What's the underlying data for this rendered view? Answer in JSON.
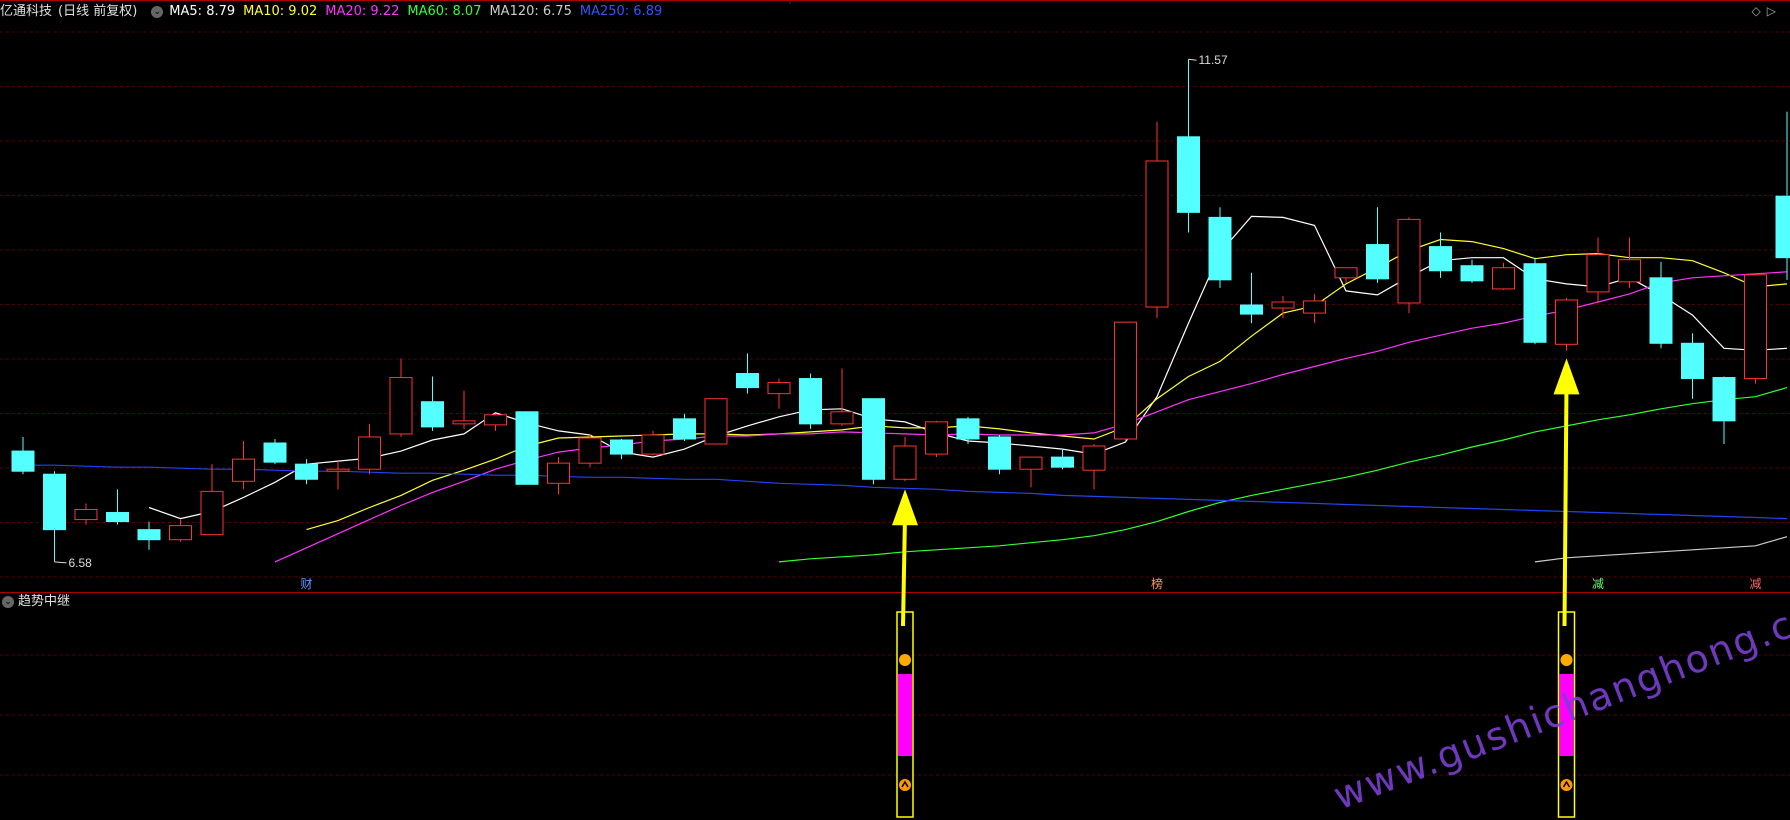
{
  "header": {
    "stock_name": "亿通科技",
    "period_label": "(日线 前复权)",
    "ma_labels": [
      {
        "label": "MA5: 8.79",
        "color": "#ffffff"
      },
      {
        "label": "MA10: 9.02",
        "color": "#ffff33"
      },
      {
        "label": "MA20: 9.22",
        "color": "#ff33ff"
      },
      {
        "label": "MA60: 8.07",
        "color": "#33ff33"
      },
      {
        "label": "MA120: 6.75",
        "color": "#cccccc"
      },
      {
        "label": "MA250: 6.89",
        "color": "#3355ff"
      }
    ]
  },
  "indicator": {
    "name": "趋势中继"
  },
  "chart_data": {
    "type": "candlestick",
    "price_high_label": "11.57",
    "price_low_label": "6.58",
    "y_range": [
      6.4,
      11.9
    ],
    "candles": [
      {
        "o": 7.68,
        "h": 7.82,
        "c": 7.48,
        "l": 7.45,
        "up": false
      },
      {
        "o": 7.45,
        "h": 7.48,
        "c": 6.9,
        "l": 6.58,
        "up": false
      },
      {
        "o": 7.0,
        "h": 7.16,
        "c": 7.1,
        "l": 6.95,
        "up": true
      },
      {
        "o": 7.07,
        "h": 7.3,
        "c": 6.98,
        "l": 6.95,
        "up": false
      },
      {
        "o": 6.9,
        "h": 6.98,
        "c": 6.8,
        "l": 6.7,
        "up": false
      },
      {
        "o": 6.8,
        "h": 7.0,
        "c": 6.94,
        "l": 6.78,
        "up": true
      },
      {
        "o": 6.85,
        "h": 7.55,
        "c": 7.28,
        "l": 6.85,
        "up": true
      },
      {
        "o": 7.38,
        "h": 7.78,
        "c": 7.6,
        "l": 7.3,
        "up": true
      },
      {
        "o": 7.76,
        "h": 7.8,
        "c": 7.57,
        "l": 7.55,
        "up": false
      },
      {
        "o": 7.55,
        "h": 7.6,
        "c": 7.4,
        "l": 7.35,
        "up": false
      },
      {
        "o": 7.5,
        "h": 7.58,
        "c": 7.48,
        "l": 7.3,
        "up": true
      },
      {
        "o": 7.5,
        "h": 7.95,
        "c": 7.82,
        "l": 7.45,
        "up": true
      },
      {
        "o": 7.85,
        "h": 8.6,
        "c": 8.41,
        "l": 7.82,
        "up": true
      },
      {
        "o": 8.17,
        "h": 8.42,
        "c": 7.92,
        "l": 7.88,
        "up": false
      },
      {
        "o": 7.98,
        "h": 8.28,
        "c": 7.95,
        "l": 7.9,
        "up": true
      },
      {
        "o": 7.94,
        "h": 8.05,
        "c": 8.04,
        "l": 7.88,
        "up": true
      },
      {
        "o": 8.07,
        "h": 8.07,
        "c": 7.35,
        "l": 7.35,
        "up": false
      },
      {
        "o": 7.36,
        "h": 7.62,
        "c": 7.56,
        "l": 7.25,
        "up": true
      },
      {
        "o": 7.56,
        "h": 7.85,
        "c": 7.81,
        "l": 7.52,
        "up": true
      },
      {
        "o": 7.79,
        "h": 7.8,
        "c": 7.65,
        "l": 7.6,
        "up": false
      },
      {
        "o": 7.65,
        "h": 7.88,
        "c": 7.84,
        "l": 7.64,
        "up": true
      },
      {
        "o": 8.0,
        "h": 8.05,
        "c": 7.8,
        "l": 7.78,
        "up": false
      },
      {
        "o": 7.75,
        "h": 8.15,
        "c": 8.2,
        "l": 7.75,
        "up": true
      },
      {
        "o": 8.45,
        "h": 8.65,
        "c": 8.31,
        "l": 8.25,
        "up": false
      },
      {
        "o": 8.25,
        "h": 8.4,
        "c": 8.36,
        "l": 8.1,
        "up": true
      },
      {
        "o": 8.4,
        "h": 8.45,
        "c": 7.95,
        "l": 7.9,
        "up": false
      },
      {
        "o": 7.95,
        "h": 8.5,
        "c": 8.07,
        "l": 7.93,
        "up": true
      },
      {
        "o": 8.2,
        "h": 8.2,
        "c": 7.4,
        "l": 7.35,
        "up": false
      },
      {
        "o": 7.4,
        "h": 7.82,
        "c": 7.73,
        "l": 7.38,
        "up": true
      },
      {
        "o": 7.65,
        "h": 7.98,
        "c": 7.97,
        "l": 7.62,
        "up": true
      },
      {
        "o": 8.0,
        "h": 8.02,
        "c": 7.8,
        "l": 7.75,
        "up": false
      },
      {
        "o": 7.82,
        "h": 7.84,
        "c": 7.5,
        "l": 7.45,
        "up": false
      },
      {
        "o": 7.5,
        "h": 7.62,
        "c": 7.62,
        "l": 7.32,
        "up": true
      },
      {
        "o": 7.62,
        "h": 7.7,
        "c": 7.52,
        "l": 7.5,
        "up": false
      },
      {
        "o": 7.49,
        "h": 7.75,
        "c": 7.73,
        "l": 7.3,
        "up": true
      },
      {
        "o": 7.8,
        "h": 8.95,
        "c": 8.96,
        "l": 7.78,
        "up": true
      },
      {
        "o": 9.11,
        "h": 10.95,
        "c": 10.56,
        "l": 9.0,
        "up": true
      },
      {
        "o": 10.8,
        "h": 11.57,
        "c": 10.05,
        "l": 9.85,
        "up": false
      },
      {
        "o": 10.0,
        "h": 10.1,
        "c": 9.38,
        "l": 9.3,
        "up": false
      },
      {
        "o": 9.13,
        "h": 9.45,
        "c": 9.04,
        "l": 8.95,
        "up": false
      },
      {
        "o": 9.1,
        "h": 9.22,
        "c": 9.16,
        "l": 9.0,
        "up": true
      },
      {
        "o": 9.05,
        "h": 9.24,
        "c": 9.17,
        "l": 8.95,
        "up": true
      },
      {
        "o": 9.4,
        "h": 9.5,
        "c": 9.5,
        "l": 9.35,
        "up": true
      },
      {
        "o": 9.73,
        "h": 10.1,
        "c": 9.39,
        "l": 9.35,
        "up": false
      },
      {
        "o": 9.15,
        "h": 10.0,
        "c": 9.98,
        "l": 9.05,
        "up": true
      },
      {
        "o": 9.71,
        "h": 9.85,
        "c": 9.47,
        "l": 9.4,
        "up": false
      },
      {
        "o": 9.52,
        "h": 9.58,
        "c": 9.37,
        "l": 9.35,
        "up": false
      },
      {
        "o": 9.29,
        "h": 9.55,
        "c": 9.5,
        "l": 9.28,
        "up": true
      },
      {
        "o": 9.54,
        "h": 9.6,
        "c": 8.76,
        "l": 8.74,
        "up": false
      },
      {
        "o": 8.74,
        "h": 9.2,
        "c": 9.18,
        "l": 8.68,
        "up": true
      },
      {
        "o": 9.26,
        "h": 9.8,
        "c": 9.63,
        "l": 9.15,
        "up": true
      },
      {
        "o": 9.36,
        "h": 9.8,
        "c": 9.58,
        "l": 9.3,
        "up": true
      },
      {
        "o": 9.4,
        "h": 9.56,
        "c": 8.75,
        "l": 8.7,
        "up": false
      },
      {
        "o": 8.75,
        "h": 8.85,
        "c": 8.4,
        "l": 8.2,
        "up": false
      },
      {
        "o": 8.41,
        "h": 8.42,
        "c": 7.98,
        "l": 7.75,
        "up": false
      },
      {
        "o": 8.4,
        "h": 9.4,
        "c": 9.43,
        "l": 8.35,
        "up": true
      },
      {
        "o": 9.6,
        "h": 11.05,
        "c": 10.21,
        "l": 9.38,
        "up": false
      }
    ],
    "ma_series": [
      {
        "label": "MA5",
        "color": "#ffffff",
        "values": [
          null,
          null,
          null,
          null,
          7.12,
          7.01,
          7.08,
          7.22,
          7.37,
          7.55,
          7.58,
          7.61,
          7.68,
          7.79,
          7.85,
          8.06,
          7.96,
          7.88,
          7.84,
          7.67,
          7.62,
          7.7,
          7.83,
          7.93,
          8.02,
          8.09,
          8.1,
          8.0,
          7.97,
          7.86,
          7.78,
          7.76,
          7.73,
          7.7,
          7.65,
          7.77,
          8.22,
          8.95,
          9.65,
          10.01,
          10.0,
          9.92,
          9.27,
          9.23,
          9.41,
          9.57,
          9.6,
          9.6,
          9.39,
          9.34,
          9.31,
          9.4,
          9.23,
          9.03,
          8.7,
          8.68,
          8.7
        ]
      },
      {
        "label": "MA10",
        "color": "#ffff33",
        "values": [
          null,
          null,
          null,
          null,
          null,
          null,
          null,
          null,
          null,
          6.9,
          6.99,
          7.12,
          7.24,
          7.39,
          7.49,
          7.6,
          7.73,
          7.81,
          7.82,
          7.83,
          7.84,
          7.85,
          7.85,
          7.84,
          7.85,
          7.87,
          7.89,
          7.93,
          7.91,
          7.91,
          7.93,
          7.9,
          7.86,
          7.83,
          7.8,
          7.92,
          8.2,
          8.42,
          8.57,
          8.82,
          9.05,
          9.12,
          9.34,
          9.5,
          9.67,
          9.78,
          9.76,
          9.69,
          9.59,
          9.63,
          9.64,
          9.6,
          9.6,
          9.57,
          9.45,
          9.31,
          9.34
        ]
      },
      {
        "label": "MA20",
        "color": "#ff33ff",
        "values": [
          null,
          null,
          null,
          null,
          null,
          null,
          null,
          null,
          6.58,
          6.72,
          6.86,
          7.0,
          7.14,
          7.27,
          7.38,
          7.5,
          7.59,
          7.67,
          7.71,
          7.74,
          7.78,
          7.8,
          7.83,
          7.83,
          7.85,
          7.85,
          7.87,
          7.86,
          7.85,
          7.84,
          7.85,
          7.84,
          7.84,
          7.84,
          7.86,
          7.95,
          8.07,
          8.19,
          8.27,
          8.35,
          8.44,
          8.52,
          8.6,
          8.67,
          8.76,
          8.83,
          8.9,
          8.95,
          9.02,
          9.08,
          9.16,
          9.24,
          9.35,
          9.4,
          9.42,
          9.44,
          9.46
        ]
      },
      {
        "label": "MA60",
        "color": "#33ff33",
        "values": [
          null,
          null,
          null,
          null,
          null,
          null,
          null,
          null,
          null,
          null,
          null,
          null,
          null,
          null,
          null,
          null,
          null,
          null,
          null,
          null,
          null,
          null,
          null,
          null,
          6.58,
          6.61,
          6.63,
          6.65,
          6.68,
          6.7,
          6.72,
          6.74,
          6.77,
          6.8,
          6.84,
          6.9,
          6.98,
          7.08,
          7.17,
          7.24,
          7.3,
          7.36,
          7.42,
          7.49,
          7.57,
          7.64,
          7.72,
          7.79,
          7.87,
          7.93,
          7.99,
          8.04,
          8.1,
          8.15,
          8.19,
          8.22,
          8.31
        ]
      },
      {
        "label": "MA120",
        "color": "#cccccc",
        "values": [
          null,
          null,
          null,
          null,
          null,
          null,
          null,
          null,
          null,
          null,
          null,
          null,
          null,
          null,
          null,
          null,
          null,
          null,
          null,
          null,
          null,
          null,
          null,
          null,
          null,
          null,
          null,
          null,
          null,
          null,
          null,
          null,
          null,
          null,
          null,
          null,
          null,
          null,
          null,
          null,
          null,
          null,
          null,
          null,
          null,
          null,
          null,
          null,
          6.58,
          6.62,
          6.64,
          6.66,
          6.68,
          6.7,
          6.72,
          6.74,
          6.83
        ]
      },
      {
        "label": "MA250",
        "color": "#2244ee",
        "values": [
          7.54,
          7.54,
          7.53,
          7.52,
          7.52,
          7.51,
          7.5,
          7.5,
          7.49,
          7.48,
          7.48,
          7.47,
          7.46,
          7.46,
          7.45,
          7.44,
          7.44,
          7.43,
          7.42,
          7.42,
          7.41,
          7.4,
          7.4,
          7.38,
          7.36,
          7.35,
          7.34,
          7.32,
          7.31,
          7.3,
          7.28,
          7.27,
          7.26,
          7.24,
          7.23,
          7.22,
          7.21,
          7.2,
          7.19,
          7.18,
          7.17,
          7.16,
          7.15,
          7.14,
          7.13,
          7.12,
          7.11,
          7.1,
          7.09,
          7.08,
          7.07,
          7.06,
          7.05,
          7.04,
          7.03,
          7.02,
          7.01
        ]
      }
    ],
    "event_markers": [
      {
        "label": "财",
        "index": 9,
        "color": "#6699ff"
      },
      {
        "label": "榜",
        "index": 36,
        "color": "#ff9966"
      },
      {
        "label": "减",
        "index": 50,
        "color": "#66ff66"
      },
      {
        "label": "减",
        "index": 55,
        "color": "#ff6666"
      }
    ],
    "signals": [
      {
        "index": 28
      },
      {
        "index": 49
      }
    ]
  },
  "watermark": "www.gushichanghong.com"
}
